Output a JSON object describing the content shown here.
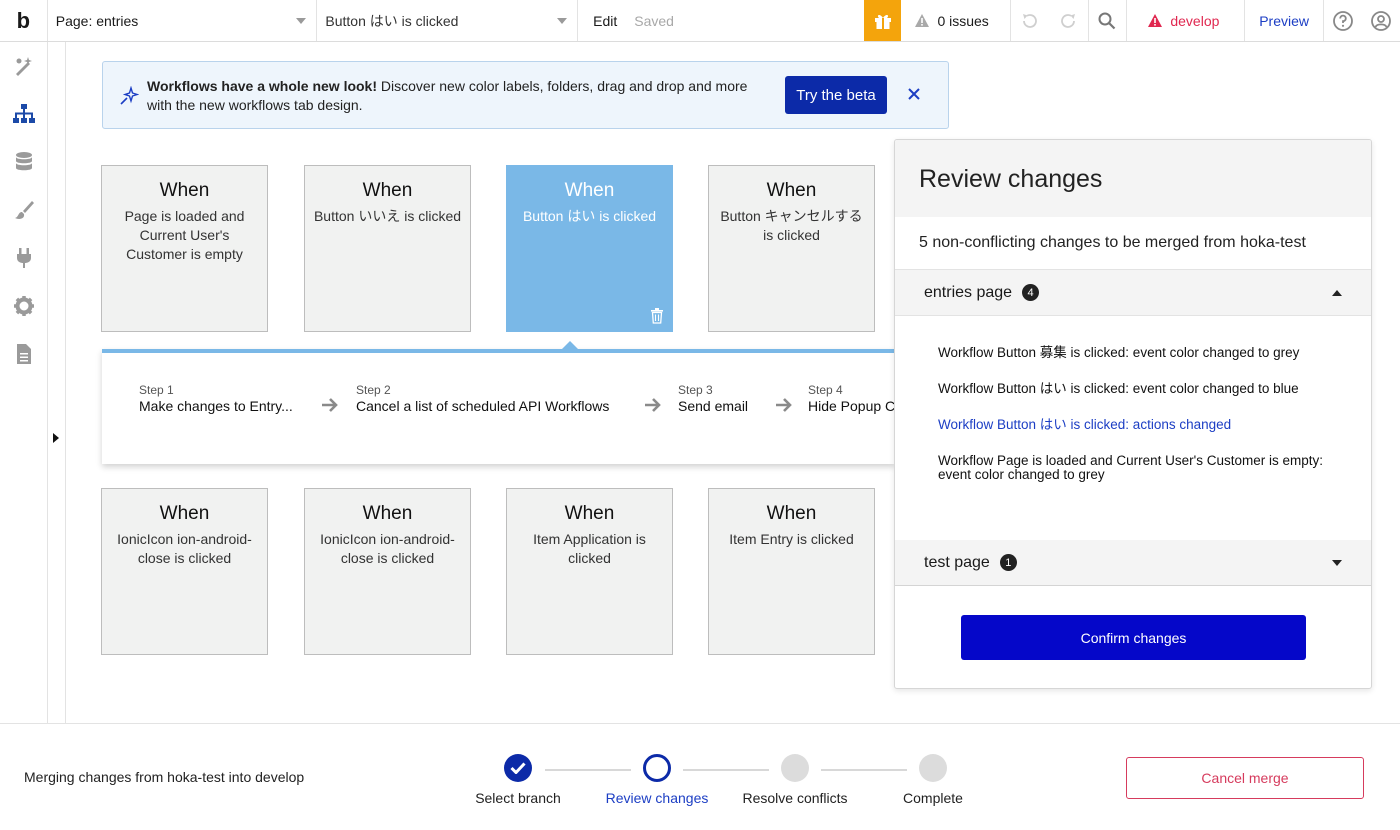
{
  "topbar": {
    "logo": "b",
    "page_select": "Page: entries",
    "workflow_select": "Button はい is clicked",
    "edit_label": "Edit",
    "saved_label": "Saved",
    "issues_label": "0 issues",
    "branch_label": "develop",
    "preview_label": "Preview"
  },
  "banner": {
    "bold_text": "Workflows have a whole new look!",
    "text": " Discover new color labels, folders, drag and drop and more with the new workflows tab design.",
    "button_label": "Try the beta"
  },
  "cards": [
    {
      "when": "When",
      "desc": "Page is loaded and Current User's Customer is empty"
    },
    {
      "when": "When",
      "desc": "Button いいえ is clicked"
    },
    {
      "when": "When",
      "desc": "Button はい is clicked"
    },
    {
      "when": "When",
      "desc": "Button キャンセルする is clicked"
    },
    {
      "when": "When",
      "desc": "IonicIcon ion-android-close is clicked"
    },
    {
      "when": "When",
      "desc": "IonicIcon ion-android-close is clicked"
    },
    {
      "when": "When",
      "desc": "Item Application is clicked"
    },
    {
      "when": "When",
      "desc": "Item Entry is clicked"
    }
  ],
  "steps": [
    {
      "num": "Step 1",
      "label": "Make changes to Entry..."
    },
    {
      "num": "Step 2",
      "label": "Cancel a list of scheduled API Workflows"
    },
    {
      "num": "Step 3",
      "label": "Send email"
    },
    {
      "num": "Step 4",
      "label": "Hide Popup C"
    }
  ],
  "review": {
    "title": "Review changes",
    "summary": "5 non-conflicting changes to be merged from hoka-test",
    "sections": [
      {
        "name": "entries page",
        "count": "4"
      },
      {
        "name": "test page",
        "count": "1"
      }
    ],
    "changes": [
      "Workflow Button 募集 is clicked: event color changed to grey",
      "Workflow Button はい is clicked: event color changed to blue",
      "Workflow Button はい is clicked: actions changed",
      "Workflow Page is loaded and Current User's Customer is empty: event color changed to grey"
    ],
    "confirm_label": "Confirm changes"
  },
  "merge": {
    "status_text": "Merging changes from hoka-test into develop",
    "progress": [
      {
        "label": "Select branch",
        "state": "done"
      },
      {
        "label": "Review changes",
        "state": "current"
      },
      {
        "label": "Resolve conflicts",
        "state": "todo"
      },
      {
        "label": "Complete",
        "state": "todo"
      }
    ],
    "cancel_label": "Cancel merge"
  },
  "colors": {
    "accent": "#0c2aa8",
    "selected_card": "#7ab8e7",
    "gift": "#f4a40c",
    "develop": "#e02850",
    "confirm": "#0507c9",
    "cancel": "#d63b5d"
  },
  "icons": [
    "gift-icon",
    "warning-icon",
    "undo-icon",
    "redo-icon",
    "search-icon",
    "help-icon",
    "user-icon",
    "design-icon",
    "workflow-icon",
    "data-icon",
    "styles-icon",
    "plugins-icon",
    "settings-icon",
    "logs-icon",
    "sparkle-icon",
    "close-icon",
    "trash-icon",
    "arrow-right-icon",
    "check-icon"
  ]
}
